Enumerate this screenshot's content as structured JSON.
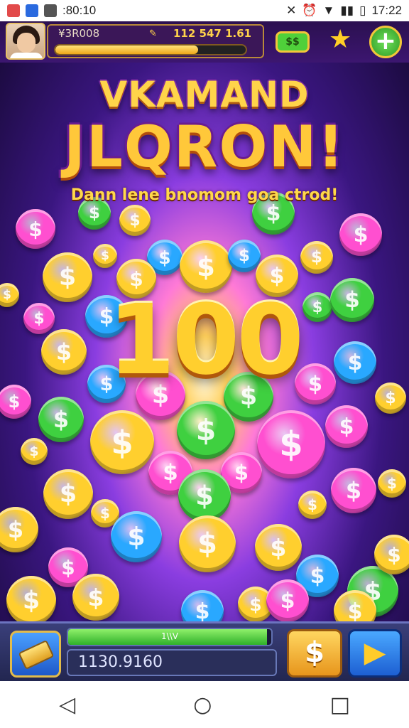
{
  "status_bar": {
    "time_left": ":80:10",
    "time_right": "17:22"
  },
  "hud": {
    "player_name": "¥3R008",
    "score": "112 547 1.61",
    "progress": 0.75,
    "cash_label": "$$",
    "star_icon": "star-icon",
    "plus_icon": "plus-icon"
  },
  "title": {
    "line1": "VKAMAND",
    "line2": "JLQRON!",
    "subtitle": "Dann lene bnomom goa ctrod!"
  },
  "center": {
    "big_number": "100"
  },
  "bottom": {
    "meter_label": "1\\\\V",
    "meter_fill": 0.98,
    "amount": "1130.9160",
    "dollar_label": "$",
    "play_icon": "play-icon"
  },
  "colors": {
    "gold": "#ffcf2e",
    "green": "#3fd040",
    "pink": "#ff4fd0",
    "blue": "#29a8ff",
    "purple_bg": "#3a1680"
  }
}
